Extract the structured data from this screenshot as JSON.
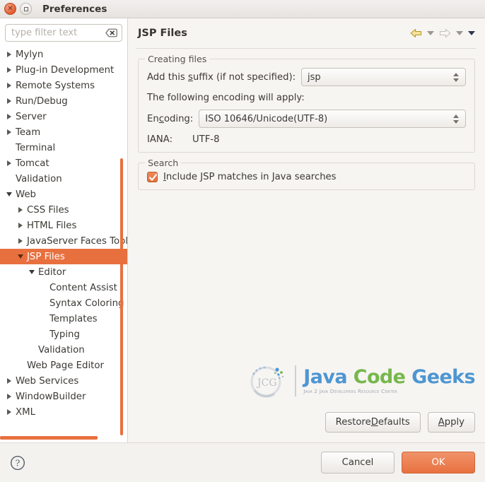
{
  "window": {
    "title": "Preferences",
    "close_icon": "close-icon",
    "maximize_icon": "maximize-icon"
  },
  "sidebar": {
    "filter": {
      "placeholder": "type filter text",
      "value": "",
      "clear_icon": "clear-icon"
    },
    "items": [
      {
        "label": "Mylyn",
        "indent": 0,
        "state": "collapsed",
        "selected": false
      },
      {
        "label": "Plug-in Development",
        "indent": 0,
        "state": "collapsed",
        "selected": false
      },
      {
        "label": "Remote Systems",
        "indent": 0,
        "state": "collapsed",
        "selected": false
      },
      {
        "label": "Run/Debug",
        "indent": 0,
        "state": "collapsed",
        "selected": false
      },
      {
        "label": "Server",
        "indent": 0,
        "state": "collapsed",
        "selected": false
      },
      {
        "label": "Team",
        "indent": 0,
        "state": "collapsed",
        "selected": false
      },
      {
        "label": "Terminal",
        "indent": 0,
        "state": "leaf",
        "selected": false
      },
      {
        "label": "Tomcat",
        "indent": 0,
        "state": "collapsed",
        "selected": false
      },
      {
        "label": "Validation",
        "indent": 0,
        "state": "leaf",
        "selected": false
      },
      {
        "label": "Web",
        "indent": 0,
        "state": "expanded",
        "selected": false
      },
      {
        "label": "CSS Files",
        "indent": 1,
        "state": "collapsed",
        "selected": false
      },
      {
        "label": "HTML Files",
        "indent": 1,
        "state": "collapsed",
        "selected": false
      },
      {
        "label": "JavaServer Faces Tooling",
        "indent": 1,
        "state": "collapsed",
        "selected": false
      },
      {
        "label": "JSP Files",
        "indent": 1,
        "state": "expanded",
        "selected": true
      },
      {
        "label": "Editor",
        "indent": 2,
        "state": "expanded",
        "selected": false
      },
      {
        "label": "Content Assist",
        "indent": 3,
        "state": "leaf",
        "selected": false
      },
      {
        "label": "Syntax Coloring",
        "indent": 3,
        "state": "leaf",
        "selected": false
      },
      {
        "label": "Templates",
        "indent": 3,
        "state": "leaf",
        "selected": false
      },
      {
        "label": "Typing",
        "indent": 3,
        "state": "leaf",
        "selected": false
      },
      {
        "label": "Validation",
        "indent": 2,
        "state": "leaf",
        "selected": false
      },
      {
        "label": "Web Page Editor",
        "indent": 1,
        "state": "leaf",
        "selected": false
      },
      {
        "label": "Web Services",
        "indent": 0,
        "state": "collapsed",
        "selected": false
      },
      {
        "label": "WindowBuilder",
        "indent": 0,
        "state": "collapsed",
        "selected": false
      },
      {
        "label": "XML",
        "indent": 0,
        "state": "collapsed",
        "selected": false
      }
    ]
  },
  "page": {
    "title": "JSP Files",
    "nav": {
      "back_icon": "back-arrow-icon",
      "back_menu_icon": "chevron-down-icon",
      "forward_icon": "forward-arrow-icon",
      "forward_menu_icon": "chevron-down-icon",
      "menu_icon": "chevron-down-icon"
    },
    "creating_files": {
      "group_label": "Creating files",
      "suffix_label_pre": "Add this ",
      "suffix_label_mnemonic": "s",
      "suffix_label_post": "uffix (if not specified):",
      "suffix_value": "jsp",
      "encoding_note": "The following encoding will apply:",
      "encoding_label_pre": "En",
      "encoding_label_mnemonic": "c",
      "encoding_label_post": "oding:",
      "encoding_value": "ISO 10646/Unicode(UTF-8)",
      "iana_label": "IANA:",
      "iana_value": "UTF-8"
    },
    "search": {
      "group_label": "Search",
      "checkbox_checked": true,
      "checkbox_label_mnemonic": "I",
      "checkbox_label_rest": "nclude JSP matches in Java searches"
    },
    "actions": {
      "restore_defaults_pre": "Restore ",
      "restore_defaults_mnemonic": "D",
      "restore_defaults_post": "efaults",
      "apply_mnemonic": "A",
      "apply_post": "pply"
    }
  },
  "watermark": {
    "word1": "Java",
    "word2": "Code",
    "word3": "Geeks",
    "tagline": "Java 2 Java Developers Resource Center",
    "logo_text": "JCG"
  },
  "footer": {
    "help_icon": "help-icon",
    "cancel_label": "Cancel",
    "ok_label": "OK"
  },
  "colors": {
    "accent": "#e8703f",
    "selection": "#e8703f",
    "ok_button": "#e8713f",
    "logo_blue": "#3f8fd0",
    "logo_green": "#6cb33f"
  }
}
